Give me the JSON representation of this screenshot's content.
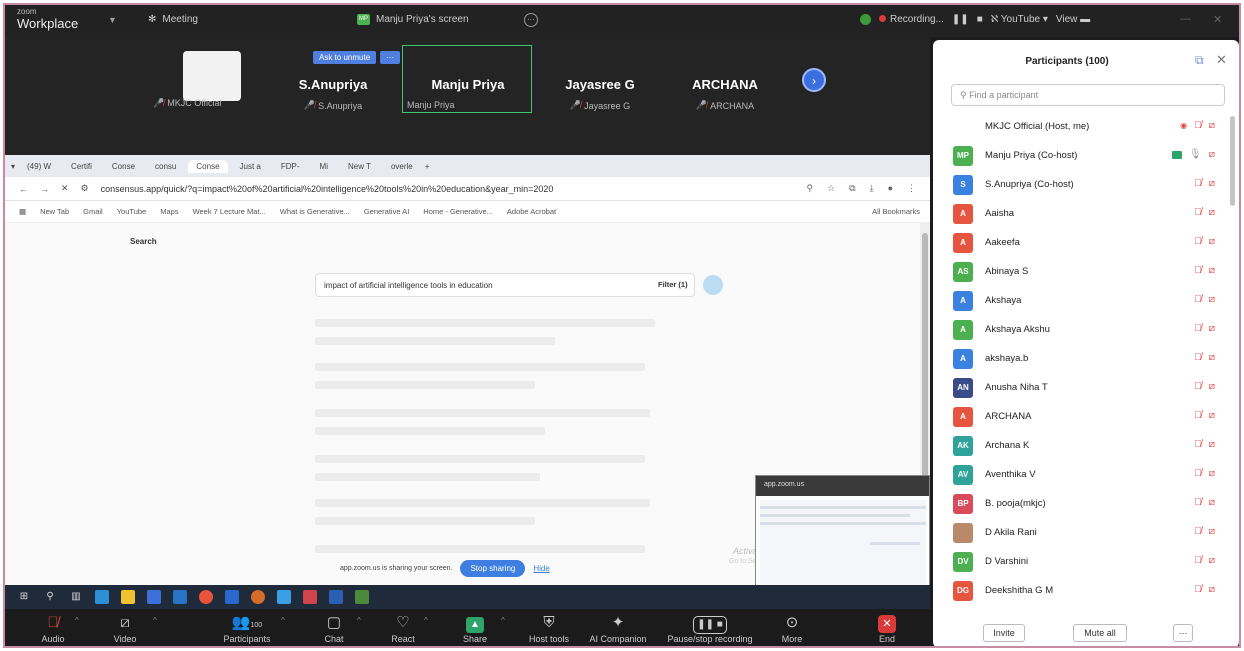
{
  "app": {
    "brand_small": "zoom",
    "brand_large": "Workplace"
  },
  "topbar": {
    "meeting_label": "Meeting",
    "screen_owner_avatar": "MP",
    "screen_label": "Manju Priya's screen",
    "recording_label": "Recording...",
    "youtube_label": "YouTube",
    "view_label": "View"
  },
  "gallery": {
    "ask_unmute": "Ask to unmute",
    "more_dots": "···",
    "self_label": "MKJC Official",
    "tiles": [
      {
        "name": "S.Anupriya",
        "sub": "S.Anupriya"
      },
      {
        "name": "Manju Priya",
        "sub": "Manju Priya"
      },
      {
        "name": "Jayasree G",
        "sub": "Jayasree G"
      },
      {
        "name": "ARCHANA",
        "sub": "ARCHANA"
      }
    ]
  },
  "browser": {
    "tabs": [
      "(49) W",
      "Certifi",
      "Conse",
      "consu",
      "Conse",
      "Just a",
      "FDP-",
      "Mi",
      "New T",
      "overle"
    ],
    "url": "consensus.app/quick/?q=impact%20of%20artificial%20intelligence%20tools%20in%20education&year_min=2020",
    "bookmarks": [
      "New Tab",
      "Gmail",
      "YouTube",
      "Maps",
      "Week 7 Lecture Mat...",
      "What is Generative...",
      "Generative AI",
      "Home - Generative...",
      "Adobe Acrobat"
    ],
    "all_bookmarks": "All Bookmarks",
    "page_heading": "Search",
    "query": "impact of artificial intelligence tools in education",
    "filter_label": "Filter (1)"
  },
  "share_bar": {
    "notice": "app.zoom.us is sharing your screen.",
    "stop_label": "Stop sharing",
    "hide_label": "Hide"
  },
  "overlay": {
    "activate_title": "Activate Windows",
    "activate_sub": "Go to Settings to activate Windows.",
    "pip_title": "app.zoom.us"
  },
  "toolbar": {
    "audio": "Audio",
    "video": "Video",
    "participants": "Participants",
    "participants_count": "100",
    "chat": "Chat",
    "react": "React",
    "share": "Share",
    "host_tools": "Host tools",
    "ai_companion": "AI Companion",
    "pause_recording": "Pause/stop recording",
    "more": "More",
    "end": "End"
  },
  "panel": {
    "title": "Participants (100)",
    "search_placeholder": "Find a participant",
    "invite": "Invite",
    "mute_all": "Mute all",
    "more": "···",
    "participants": [
      {
        "initials": "",
        "name": "MKJC Official (Host, me)",
        "color": "#ffffff"
      },
      {
        "initials": "MP",
        "name": "Manju Priya (Co-host)",
        "color": "#4caf50"
      },
      {
        "initials": "S",
        "name": "S.Anupriya (Co-host)",
        "color": "#3b82e0"
      },
      {
        "initials": "A",
        "name": "Aaisha",
        "color": "#e5553f"
      },
      {
        "initials": "A",
        "name": "Aakeefa",
        "color": "#e5553f"
      },
      {
        "initials": "AS",
        "name": "Abinaya S",
        "color": "#4caf50"
      },
      {
        "initials": "A",
        "name": "Akshaya",
        "color": "#3b82e0"
      },
      {
        "initials": "A",
        "name": "Akshaya Akshu",
        "color": "#4caf50"
      },
      {
        "initials": "A",
        "name": "akshaya.b",
        "color": "#3b82e0"
      },
      {
        "initials": "AN",
        "name": "Anusha Niha T",
        "color": "#3a4a8a"
      },
      {
        "initials": "A",
        "name": "ARCHANA",
        "color": "#e5553f"
      },
      {
        "initials": "AK",
        "name": "Archana K",
        "color": "#2fa39a"
      },
      {
        "initials": "AV",
        "name": "Aventhika V",
        "color": "#2fa39a"
      },
      {
        "initials": "BP",
        "name": "B. pooja(mkjc)",
        "color": "#d94a5a"
      },
      {
        "initials": "",
        "name": "D Akila Rani",
        "color": "#b88a6a"
      },
      {
        "initials": "DV",
        "name": "D Varshini",
        "color": "#4caf50"
      },
      {
        "initials": "DG",
        "name": "Deekshitha G M",
        "color": "#e5553f"
      }
    ]
  }
}
